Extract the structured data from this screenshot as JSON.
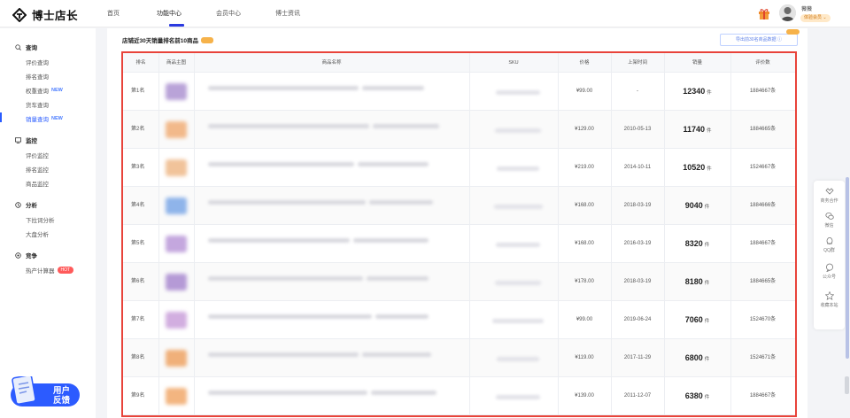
{
  "app": {
    "brand": "博士店长"
  },
  "nav": {
    "items": [
      {
        "label": "首页",
        "active": false
      },
      {
        "label": "功能中心",
        "active": true
      },
      {
        "label": "会员中心",
        "active": false
      },
      {
        "label": "博士资讯",
        "active": false
      }
    ],
    "accent": "#2b3ae0"
  },
  "user": {
    "name": "薇薇",
    "member_badge": "体验会员 ⌄"
  },
  "sidebar": {
    "sections": [
      {
        "title": "查询",
        "icon": "search-icon",
        "items": [
          {
            "label": "评价查询"
          },
          {
            "label": "排名查询"
          },
          {
            "label": "权重查询",
            "tag": "NEW"
          },
          {
            "label": "货车查询"
          },
          {
            "label": "销量查询",
            "tag": "NEW",
            "active": true
          }
        ]
      },
      {
        "title": "监控",
        "icon": "monitor-icon",
        "items": [
          {
            "label": "评价监控"
          },
          {
            "label": "排名监控"
          },
          {
            "label": "商品监控"
          }
        ]
      },
      {
        "title": "分析",
        "icon": "analysis-icon",
        "items": [
          {
            "label": "下拉词分析"
          },
          {
            "label": "大盘分析"
          }
        ]
      },
      {
        "title": "竞争",
        "icon": "target-icon",
        "items": [
          {
            "label": "热产计算器",
            "tag": "HOT"
          }
        ]
      }
    ],
    "feedback_label_1": "用户",
    "feedback_label_2": "反馈"
  },
  "main": {
    "title": "店铺近30天销量排名前10商品",
    "export_label": "导出前30名商品数据 ⓘ",
    "columns": [
      "排名",
      "商品主图",
      "商品名称",
      "SKU",
      "价格",
      "上架时间",
      "销量",
      "评价数"
    ],
    "rows": [
      {
        "rank": "第1名",
        "price": "¥99.00",
        "date": "-",
        "sales": "12340",
        "unit": "件",
        "reviews": "1884667条",
        "thumb": "#b9a3d8"
      },
      {
        "rank": "第2名",
        "price": "¥129.00",
        "date": "2010-05-13",
        "sales": "11740",
        "unit": "件",
        "reviews": "1884665条",
        "thumb": "#f2b98a"
      },
      {
        "rank": "第3名",
        "price": "¥219.00",
        "date": "2014-10-11",
        "sales": "10520",
        "unit": "件",
        "reviews": "1524667条",
        "thumb": "#f1c39a"
      },
      {
        "rank": "第4名",
        "price": "¥168.00",
        "date": "2018-03-19",
        "sales": "9040",
        "unit": "件",
        "reviews": "1884666条",
        "thumb": "#8fb4ea"
      },
      {
        "rank": "第5名",
        "price": "¥168.00",
        "date": "2016-03-19",
        "sales": "8320",
        "unit": "件",
        "reviews": "1884667条",
        "thumb": "#c4a7de"
      },
      {
        "rank": "第6名",
        "price": "¥178.00",
        "date": "2018-03-19",
        "sales": "8180",
        "unit": "件",
        "reviews": "1884665条",
        "thumb": "#b59ad6"
      },
      {
        "rank": "第7名",
        "price": "¥99.00",
        "date": "2019-06-24",
        "sales": "7060",
        "unit": "件",
        "reviews": "1524670条",
        "thumb": "#d2aee0"
      },
      {
        "rank": "第8名",
        "price": "¥119.00",
        "date": "2017-11-29",
        "sales": "6800",
        "unit": "件",
        "reviews": "1524671条",
        "thumb": "#f0b07a"
      },
      {
        "rank": "第9名",
        "price": "¥139.00",
        "date": "2011-12-07",
        "sales": "6380",
        "unit": "件",
        "reviews": "1884667条",
        "thumb": "#f3b580"
      }
    ]
  },
  "right_bar": [
    {
      "label": "商务合作",
      "icon": "handshake-icon"
    },
    {
      "label": "微信",
      "icon": "wechat-icon"
    },
    {
      "label": "QQ群",
      "icon": "qq-icon"
    },
    {
      "label": "公众号",
      "icon": "chat-icon"
    },
    {
      "label": "收藏本站",
      "icon": "star-icon"
    }
  ],
  "colors": {
    "accent": "#2a5cff",
    "highlight_border": "#e8433a",
    "tag_hot": "#ff5a5a",
    "tag_orange": "#f6b24a"
  }
}
